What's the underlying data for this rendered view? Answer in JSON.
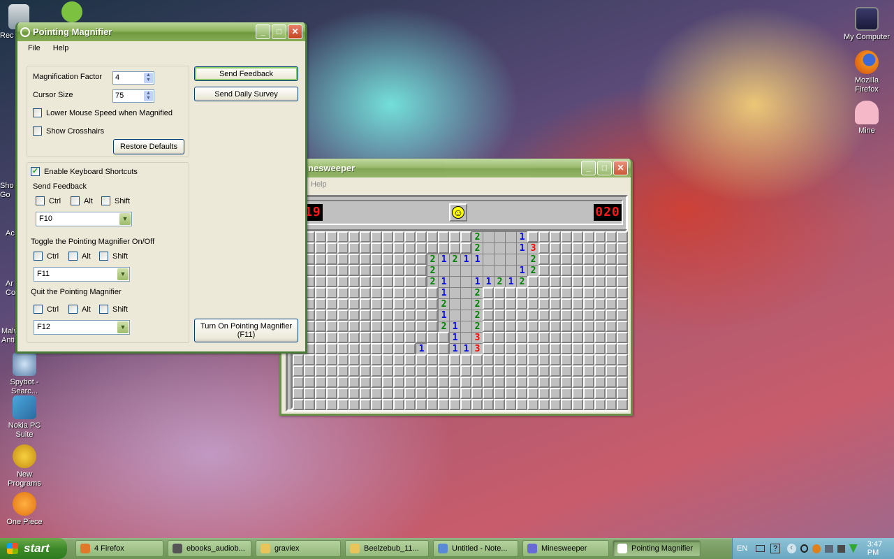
{
  "desktop": {
    "icons": [
      {
        "label": "My Computer"
      },
      {
        "label": "Mozilla Firefox"
      },
      {
        "label": "Mine"
      },
      {
        "label": "Spybot - Searc..."
      },
      {
        "label": "Nokia PC Suite"
      },
      {
        "label": "New Programs"
      },
      {
        "label": "One Piece"
      }
    ],
    "partial_labels": [
      "Rec",
      "Sho",
      "Go",
      "Ac",
      "Ar",
      "Co",
      "Malw",
      "Anti"
    ]
  },
  "magnifier": {
    "title": "Pointing Magnifier",
    "menu": [
      "File",
      "Help"
    ],
    "magnification_label": "Magnification Factor",
    "magnification_value": "4",
    "cursor_label": "Cursor Size",
    "cursor_value": "75",
    "lower_speed_label": "Lower Mouse Speed when Magnified",
    "crosshairs_label": "Show Crosshairs",
    "restore_label": "Restore Defaults",
    "send_feedback_button": "Send Feedback",
    "send_survey_button": "Send Daily Survey",
    "enable_shortcuts_label": "Enable Keyboard Shortcuts",
    "enable_shortcuts_checked": true,
    "sections": [
      {
        "title": "Send Feedback",
        "key": "F10"
      },
      {
        "title": "Toggle the Pointing Magnifier On/Off",
        "key": "F11"
      },
      {
        "title": "Quit the Pointing Magnifier",
        "key": "F12"
      }
    ],
    "modifiers": [
      "Ctrl",
      "Alt",
      "Shift"
    ],
    "turn_on_line1": "Turn On Pointing Magnifier",
    "turn_on_line2": "(F11)"
  },
  "minesweeper": {
    "title": "nesweeper",
    "menu_help": "Help",
    "mines_counter": "019",
    "timer": "020",
    "smiley": "☺",
    "grid_cols": 30,
    "grid_rows": 16,
    "open_cells": [
      {
        "r": 0,
        "c": 16,
        "v": "2"
      },
      {
        "r": 0,
        "c": 17,
        "v": ""
      },
      {
        "r": 0,
        "c": 18,
        "v": ""
      },
      {
        "r": 0,
        "c": 19,
        "v": ""
      },
      {
        "r": 0,
        "c": 20,
        "v": "1"
      },
      {
        "r": 1,
        "c": 16,
        "v": "2"
      },
      {
        "r": 1,
        "c": 17,
        "v": ""
      },
      {
        "r": 1,
        "c": 18,
        "v": ""
      },
      {
        "r": 1,
        "c": 19,
        "v": ""
      },
      {
        "r": 1,
        "c": 20,
        "v": "1"
      },
      {
        "r": 1,
        "c": 21,
        "v": "3"
      },
      {
        "r": 2,
        "c": 12,
        "v": "2"
      },
      {
        "r": 2,
        "c": 13,
        "v": "1"
      },
      {
        "r": 2,
        "c": 14,
        "v": "2"
      },
      {
        "r": 2,
        "c": 15,
        "v": "1"
      },
      {
        "r": 2,
        "c": 16,
        "v": "1"
      },
      {
        "r": 2,
        "c": 17,
        "v": ""
      },
      {
        "r": 2,
        "c": 18,
        "v": ""
      },
      {
        "r": 2,
        "c": 19,
        "v": ""
      },
      {
        "r": 2,
        "c": 20,
        "v": ""
      },
      {
        "r": 2,
        "c": 21,
        "v": "2"
      },
      {
        "r": 3,
        "c": 12,
        "v": "2"
      },
      {
        "r": 3,
        "c": 13,
        "v": ""
      },
      {
        "r": 3,
        "c": 14,
        "v": ""
      },
      {
        "r": 3,
        "c": 15,
        "v": ""
      },
      {
        "r": 3,
        "c": 16,
        "v": ""
      },
      {
        "r": 3,
        "c": 17,
        "v": ""
      },
      {
        "r": 3,
        "c": 18,
        "v": ""
      },
      {
        "r": 3,
        "c": 19,
        "v": ""
      },
      {
        "r": 3,
        "c": 20,
        "v": "1"
      },
      {
        "r": 3,
        "c": 21,
        "v": "2"
      },
      {
        "r": 4,
        "c": 12,
        "v": "2"
      },
      {
        "r": 4,
        "c": 13,
        "v": "1"
      },
      {
        "r": 4,
        "c": 14,
        "v": ""
      },
      {
        "r": 4,
        "c": 15,
        "v": ""
      },
      {
        "r": 4,
        "c": 16,
        "v": "1"
      },
      {
        "r": 4,
        "c": 17,
        "v": "1"
      },
      {
        "r": 4,
        "c": 18,
        "v": "2"
      },
      {
        "r": 4,
        "c": 19,
        "v": "1"
      },
      {
        "r": 4,
        "c": 20,
        "v": "2"
      },
      {
        "r": 5,
        "c": 13,
        "v": "1"
      },
      {
        "r": 5,
        "c": 14,
        "v": ""
      },
      {
        "r": 5,
        "c": 15,
        "v": ""
      },
      {
        "r": 5,
        "c": 16,
        "v": "2"
      },
      {
        "r": 6,
        "c": 13,
        "v": "2"
      },
      {
        "r": 6,
        "c": 14,
        "v": ""
      },
      {
        "r": 6,
        "c": 15,
        "v": ""
      },
      {
        "r": 6,
        "c": 16,
        "v": "2"
      },
      {
        "r": 7,
        "c": 13,
        "v": "1"
      },
      {
        "r": 7,
        "c": 14,
        "v": ""
      },
      {
        "r": 7,
        "c": 15,
        "v": ""
      },
      {
        "r": 7,
        "c": 16,
        "v": "2"
      },
      {
        "r": 8,
        "c": 13,
        "v": "2"
      },
      {
        "r": 8,
        "c": 14,
        "v": "1"
      },
      {
        "r": 8,
        "c": 15,
        "v": ""
      },
      {
        "r": 8,
        "c": 16,
        "v": "2"
      },
      {
        "r": 9,
        "c": 14,
        "v": "1"
      },
      {
        "r": 9,
        "c": 15,
        "v": ""
      },
      {
        "r": 9,
        "c": 16,
        "v": "3"
      },
      {
        "r": 10,
        "c": 11,
        "v": "1"
      },
      {
        "r": 10,
        "c": 14,
        "v": "1"
      },
      {
        "r": 10,
        "c": 15,
        "v": "1"
      },
      {
        "r": 10,
        "c": 16,
        "v": "3"
      }
    ],
    "number_colors": {
      "1": "#0000ff",
      "2": "#008000",
      "3": "#ff0000"
    }
  },
  "taskbar": {
    "start_label": "start",
    "items": [
      {
        "label": "4 Firefox",
        "active": false,
        "color": "#e07a2a"
      },
      {
        "label": "ebooks_audiob...",
        "active": false,
        "color": "#555555"
      },
      {
        "label": "graviex",
        "active": false,
        "color": "#e8c45a"
      },
      {
        "label": "Beelzebub_11...",
        "active": false,
        "color": "#e8c45a"
      },
      {
        "label": "Untitled - Note...",
        "active": false,
        "color": "#5a8ad6"
      },
      {
        "label": "Minesweeper",
        "active": false,
        "color": "#6a6ad6"
      },
      {
        "label": "Pointing Magnifier",
        "active": true,
        "color": "#ffffff"
      }
    ],
    "lang": "EN",
    "clock": "3:47 PM"
  }
}
